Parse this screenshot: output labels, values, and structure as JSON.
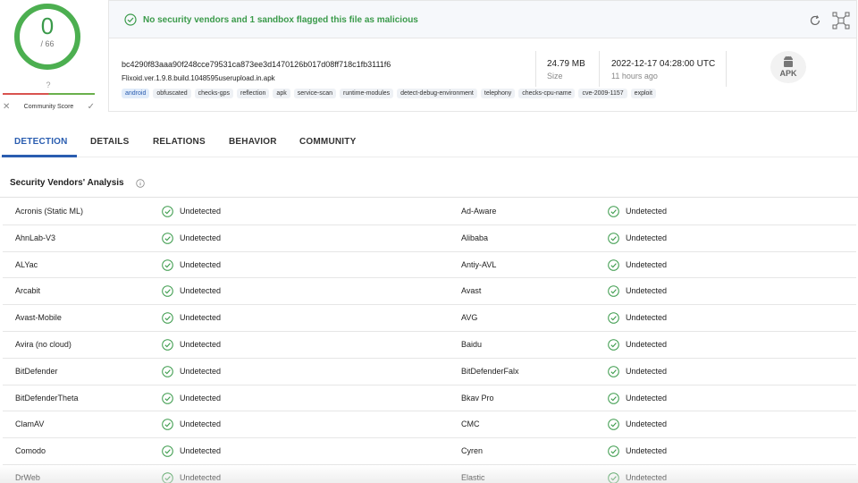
{
  "score": {
    "detections": "0",
    "total": "/ 66",
    "community_score_value": "?",
    "community_label": "Community Score"
  },
  "banner": {
    "message": "No security vendors and 1 sandbox flagged this file as malicious"
  },
  "file": {
    "hash": "bc4290f83aaa90f248cce79531ca873ee3d1470126b017d08ff718c1fb3111f6",
    "name": "Flixoid.ver.1.9.8.build.1048595userupload.in.apk",
    "size": "24.79 MB",
    "size_label": "Size",
    "date": "2022-12-17 04:28:00 UTC",
    "date_ago": "11 hours ago",
    "type_badge": "APK"
  },
  "tags": [
    "android",
    "obfuscated",
    "checks-gps",
    "reflection",
    "apk",
    "service-scan",
    "runtime-modules",
    "detect-debug-environment",
    "telephony",
    "checks-cpu-name",
    "cve-2009-1157",
    "exploit"
  ],
  "tabs": [
    "DETECTION",
    "DETAILS",
    "RELATIONS",
    "BEHAVIOR",
    "COMMUNITY"
  ],
  "section": {
    "title": "Security Vendors' Analysis"
  },
  "vendors": [
    [
      "Acronis (Static ML)",
      "Undetected",
      "Ad-Aware",
      "Undetected"
    ],
    [
      "AhnLab-V3",
      "Undetected",
      "Alibaba",
      "Undetected"
    ],
    [
      "ALYac",
      "Undetected",
      "Antiy-AVL",
      "Undetected"
    ],
    [
      "Arcabit",
      "Undetected",
      "Avast",
      "Undetected"
    ],
    [
      "Avast-Mobile",
      "Undetected",
      "AVG",
      "Undetected"
    ],
    [
      "Avira (no cloud)",
      "Undetected",
      "Baidu",
      "Undetected"
    ],
    [
      "BitDefender",
      "Undetected",
      "BitDefenderFalx",
      "Undetected"
    ],
    [
      "BitDefenderTheta",
      "Undetected",
      "Bkav Pro",
      "Undetected"
    ],
    [
      "ClamAV",
      "Undetected",
      "CMC",
      "Undetected"
    ],
    [
      "Comodo",
      "Undetected",
      "Cyren",
      "Undetected"
    ],
    [
      "DrWeb",
      "Undetected",
      "Elastic",
      "Undetected"
    ]
  ],
  "colors": {
    "clean": "#3a9a4a",
    "accent": "#2a5db0"
  },
  "icons": {
    "clean": "check-circle-icon",
    "refresh": "refresh-icon",
    "graph": "graph-icon",
    "info": "info-icon",
    "apk": "android-icon"
  }
}
